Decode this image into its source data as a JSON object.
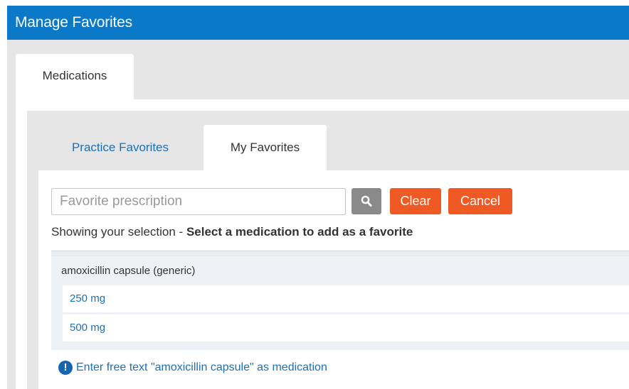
{
  "window": {
    "title": "Manage Favorites"
  },
  "outer_tabs": [
    {
      "label": "Medications",
      "active": true
    }
  ],
  "inner_tabs": [
    {
      "label": "Practice Favorites",
      "active": false
    },
    {
      "label": "My Favorites",
      "active": true
    }
  ],
  "search": {
    "placeholder": "Favorite prescription",
    "value": "",
    "search_icon": "search-icon",
    "clear_label": "Clear",
    "cancel_label": "Cancel"
  },
  "selection_hint": {
    "prefix": "Showing your selection - ",
    "emphasis": "Select a medication to add as a favorite"
  },
  "results": {
    "group_header": "amoxicillin capsule (generic)",
    "items": [
      {
        "label": "250 mg"
      },
      {
        "label": "500 mg"
      }
    ],
    "free_text_icon": "info-icon",
    "free_text_label": "Enter free text \"amoxicillin capsule\" as medication"
  },
  "colors": {
    "titlebar": "#0b79c8",
    "accent_orange": "#ef5a24",
    "link_blue": "#1f6fb5",
    "panel_grey": "#e6e6e6",
    "search_button_grey": "#8a8a8a"
  }
}
